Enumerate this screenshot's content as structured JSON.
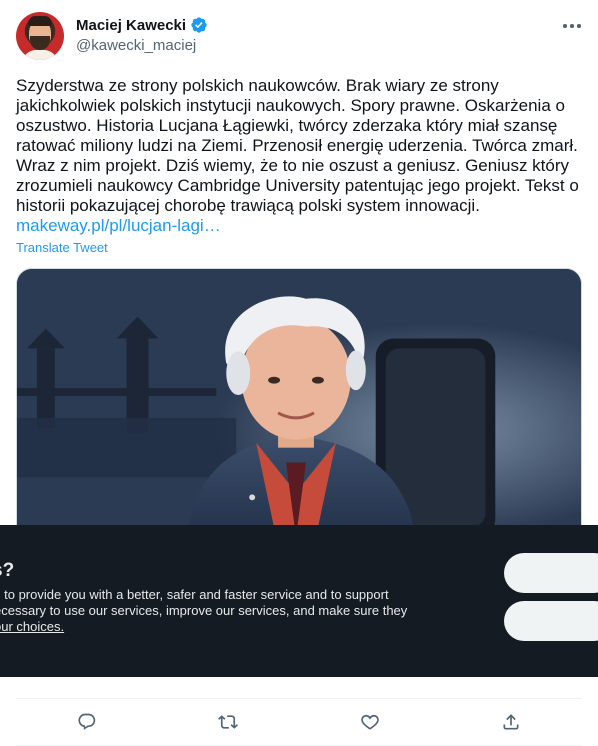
{
  "author": {
    "name": "Maciej Kawecki",
    "handle": "@kawecki_maciej",
    "verified": true
  },
  "tweet": {
    "text": "Szyderstwa ze strony polskich naukowców. Brak wiary ze strony jakichkolwiek polskich instytucji naukowych. Spory prawne. Oskarżenia o oszustwo. Historia Lucjana Łągiewki, twórcy zderzaka który miał szansę ratować miliony ludzi na Ziemi. Przenosił energię uderzenia. Twórca zmarł. Wraz z nim projekt. Dziś wiemy, że to nie oszust a geniusz. Geniusz który zrozumieli naukowcy Cambridge University patentując jego projekt. Tekst o historii pokazującej chorobę trawiącą polski system innowacji. ",
    "link_text": "makeway.pl/pl/lucjan-lagi…",
    "translate_label": "Translate Tweet"
  },
  "cookie_banner": {
    "title": "s?",
    "line1": "s to provide you with a better, safer and faster service and to support",
    "line2": "ecessary to use our services, improve our services, and make sure they",
    "link": "our choices."
  },
  "actions": {
    "reply": "reply-icon",
    "retweet": "retweet-icon",
    "like": "like-icon",
    "share": "share-icon"
  },
  "colors": {
    "accent": "#1d9bf0",
    "banner_bg": "#141b22",
    "secondary_text": "#536471"
  }
}
